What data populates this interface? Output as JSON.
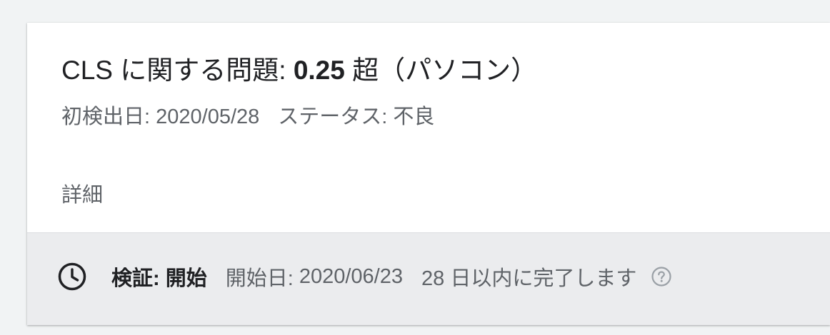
{
  "issue": {
    "title_prefix": "CLS に関する問題:",
    "title_value": "0.25",
    "title_suffix": "超（パソコン）",
    "first_detected_label": "初検出日:",
    "first_detected_date": "2020/05/28",
    "status_label": "ステータス:",
    "status_value": "不良",
    "details_label": "詳細"
  },
  "validation": {
    "icon": "clock-icon",
    "label": "検証: 開始",
    "started_label": "開始日:",
    "started_date": "2020/06/23",
    "completion_text": "28 日以内に完了します",
    "help_icon": "help-circle-icon"
  }
}
